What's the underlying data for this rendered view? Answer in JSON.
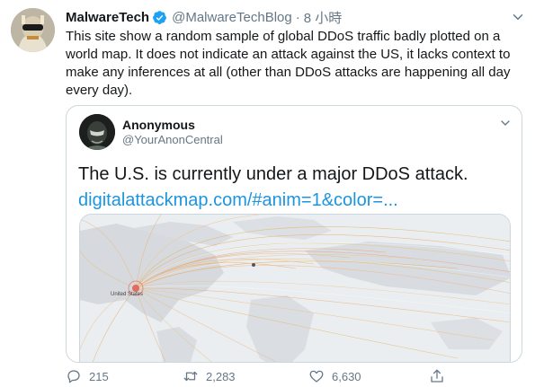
{
  "tweet": {
    "author_name": "MalwareTech",
    "handle": "@MalwareTechBlog",
    "separator": "·",
    "time": "8 小時",
    "text": "This site show a random sample of global DDoS traffic badly plotted on a world map. It does not indicate an attack against the US, it lacks context to make any inferences at all (other than DDoS attacks are happening all day every day).",
    "verified": true
  },
  "quoted": {
    "author_name": "Anonymous",
    "handle": "@YourAnonCentral",
    "text": "The U.S. is currently under a major DDoS attack.",
    "link": "digitalattackmap.com/#anim=1&color=...",
    "map_label": "United States"
  },
  "actions": {
    "replies": "215",
    "retweets": "2,283",
    "likes": "6,630"
  },
  "colors": {
    "link": "#1b95e0",
    "secondary_text": "#657786",
    "border": "#ccd6dd",
    "verified": "#1da1f2"
  },
  "icons": [
    "verified-badge-icon",
    "chevron-down-icon",
    "reply-icon",
    "retweet-icon",
    "like-icon",
    "share-icon"
  ]
}
